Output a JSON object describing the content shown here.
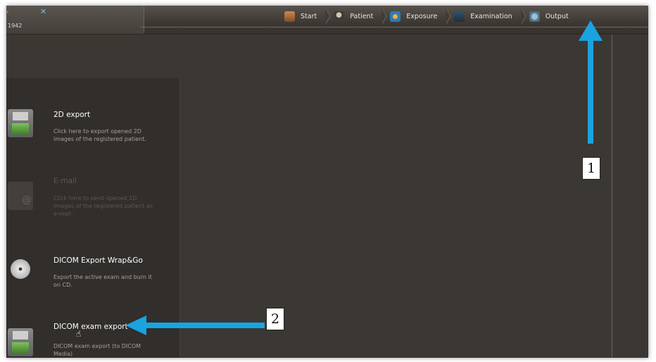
{
  "header": {
    "patient_year": "1942",
    "steps": [
      {
        "label": "Start",
        "icon": "start-house-icon"
      },
      {
        "label": "Patient",
        "icon": "patient-icon"
      },
      {
        "label": "Exposure",
        "icon": "exposure-icon"
      },
      {
        "label": "Examination",
        "icon": "examination-icon"
      },
      {
        "label": "Output",
        "icon": "output-icon"
      }
    ]
  },
  "export_panel": {
    "items": [
      {
        "title": "2D export",
        "description": "Click here to export opened 2D images of the registered patient.",
        "icon": "floppy-icon",
        "enabled": true
      },
      {
        "title": "E-mail",
        "description": "Click here to send opened 2D images of the registered patient as e-mail.",
        "icon": "email-icon",
        "enabled": false
      },
      {
        "title": "DICOM Export Wrap&Go",
        "description": "Export the active exam and burn it on CD.",
        "icon": "cd-icon",
        "enabled": true
      },
      {
        "title": "DICOM exam export",
        "description": "DICOM exam export (to DICOM Media)",
        "icon": "floppy-icon",
        "enabled": true
      }
    ]
  },
  "annotations": {
    "callout_1": "1",
    "callout_2": "2",
    "arrow_color": "#1aa3e0"
  }
}
